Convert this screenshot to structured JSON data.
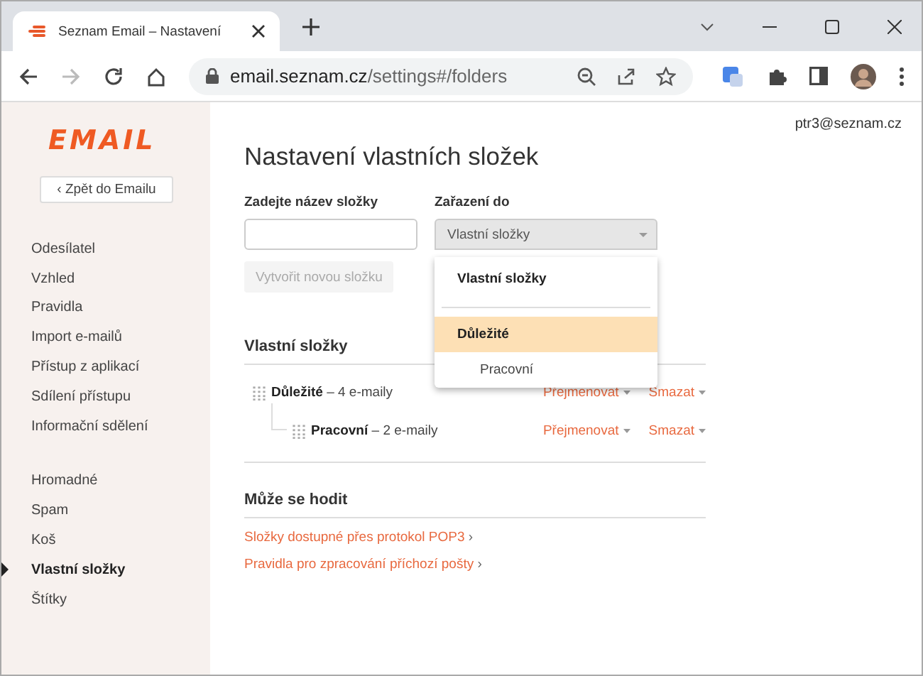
{
  "browser": {
    "tab_title": "Seznam Email – Nastavení",
    "url_host": "email.seznam.cz",
    "url_path": "/settings#/folders",
    "forward_disabled": true
  },
  "sidebar": {
    "logo": "EMAIL",
    "back_button": "‹ Zpět do Emailu",
    "groups": [
      [
        {
          "label": "Odesílatel",
          "selected": false
        },
        {
          "label": "Vzhled",
          "selected": false
        },
        {
          "label": "Pravidla",
          "selected": false
        },
        {
          "label": "Import e-mailů",
          "selected": false
        },
        {
          "label": "Přístup z aplikací",
          "selected": false
        },
        {
          "label": "Sdílení přístupu",
          "selected": false
        },
        {
          "label": "Informační sdělení",
          "selected": false
        }
      ],
      [
        {
          "label": "Hromadné",
          "selected": false
        },
        {
          "label": "Spam",
          "selected": false
        },
        {
          "label": "Koš",
          "selected": false
        },
        {
          "label": "Vlastní složky",
          "selected": true
        },
        {
          "label": "Štítky",
          "selected": false
        }
      ]
    ]
  },
  "account": "ptr3@seznam.cz",
  "title": "Nastavení vlastních složek",
  "form": {
    "name_label": "Zadejte název složky",
    "parent_label": "Zařazení do",
    "parent_value": "Vlastní složky",
    "create_button": "Vytvořit novou složku",
    "create_disabled": true
  },
  "dropdown": {
    "options": [
      {
        "label": "Vlastní složky",
        "kind": "root",
        "selected": false
      },
      {
        "label": "Důležité",
        "kind": "folder",
        "selected": true
      },
      {
        "label": "Pracovní",
        "kind": "subfolder",
        "selected": false
      }
    ]
  },
  "folders_heading": "Vlastní složky",
  "folders": [
    {
      "name": "Důležité",
      "count": "– 4 e-maily",
      "rename": "Přejmenovat",
      "delete": "Smazat",
      "children": [
        {
          "name": "Pracovní",
          "count": "– 2 e-maily",
          "rename": "Přejmenovat",
          "delete": "Smazat"
        }
      ]
    }
  ],
  "tips_heading": "Může se hodit",
  "tips": [
    {
      "label": "Složky dostupné přes protokol POP3",
      "arrow": "›"
    },
    {
      "label": "Pravidla pro zpracování příchozí pošty",
      "arrow": "›"
    }
  ]
}
